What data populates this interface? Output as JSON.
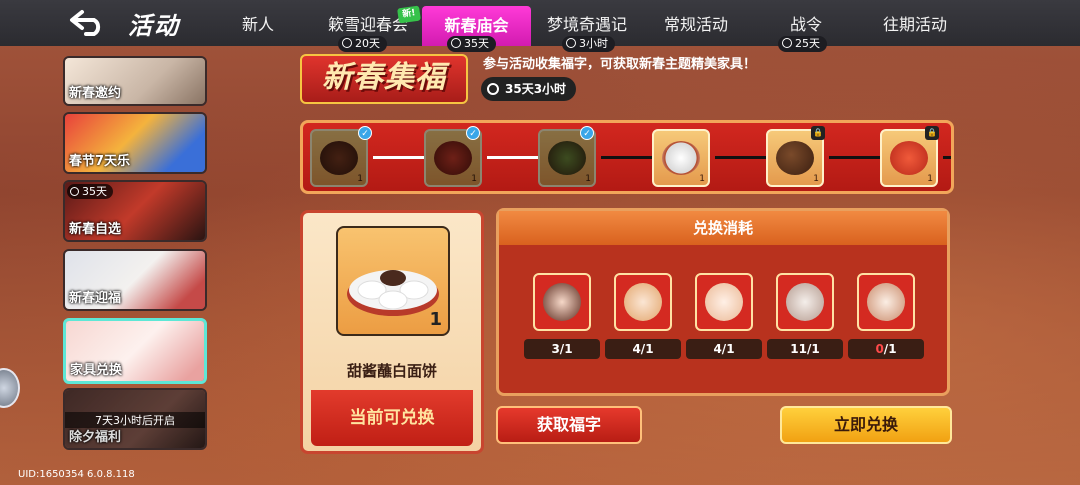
{
  "header": {
    "back_icon": "back-arrow-icon",
    "title": "活动",
    "tabs": [
      {
        "label": "新人",
        "timer": "",
        "active": false
      },
      {
        "label": "簌雪迎春会",
        "timer": "20天",
        "new": "新!",
        "active": false
      },
      {
        "label": "新春庙会",
        "timer": "35天",
        "active": true
      },
      {
        "label": "梦境奇遇记",
        "timer": "3小时",
        "active": false
      },
      {
        "label": "常规活动",
        "timer": "",
        "active": false
      },
      {
        "label": "战令",
        "timer": "25天",
        "active": false
      },
      {
        "label": "往期活动",
        "timer": "",
        "active": false
      }
    ]
  },
  "sidebar": {
    "items": [
      {
        "label": "新春邀约",
        "timer": "",
        "locked_text": ""
      },
      {
        "label": "春节7天乐",
        "timer": "",
        "locked_text": ""
      },
      {
        "label": "新春自选",
        "timer": "35天",
        "locked_text": ""
      },
      {
        "label": "新春迎福",
        "timer": "",
        "locked_text": ""
      },
      {
        "label": "家具兑换",
        "timer": "",
        "locked_text": "",
        "active": true
      },
      {
        "label": "除夕福利",
        "timer": "",
        "locked_text": "7天3小时后开启"
      }
    ]
  },
  "event": {
    "logo_text": "新春集福",
    "description": "参与活动收集福字，可获取新春主题精美家具！",
    "timer": "35天3小时"
  },
  "progress": {
    "nodes": [
      {
        "state": "claimed",
        "qty": "1",
        "icon": "pot-dish-icon"
      },
      {
        "state": "claimed",
        "qty": "1",
        "icon": "lantern-drum-icon"
      },
      {
        "state": "claimed",
        "qty": "1",
        "icon": "hotpot-icon"
      },
      {
        "state": "current",
        "qty": "1",
        "icon": "dumpling-plate-icon"
      },
      {
        "state": "locked",
        "qty": "1",
        "icon": "chestnut-icon"
      },
      {
        "state": "locked",
        "qty": "1",
        "icon": "crab-icon"
      }
    ]
  },
  "reward": {
    "qty": "1",
    "name": "甜酱蘸白面饼",
    "status": "当前可兑换"
  },
  "cost": {
    "header": "兑换消耗",
    "items": [
      {
        "have": "3",
        "need": "1",
        "short": false
      },
      {
        "have": "4",
        "need": "1",
        "short": false
      },
      {
        "have": "4",
        "need": "1",
        "short": false
      },
      {
        "have": "11",
        "need": "1",
        "short": false
      },
      {
        "have": "0",
        "need": "1",
        "short": true
      }
    ]
  },
  "buttons": {
    "get": "获取福字",
    "exchange": "立即兑换"
  },
  "footer": {
    "uid": "UID:1650354 6.0.8.118"
  },
  "colors": {
    "accent_tab": "#e026c4",
    "panel_red": "#b8321e",
    "exchange_yellow": "#f6b91f",
    "active_border": "#5ee7d6"
  }
}
